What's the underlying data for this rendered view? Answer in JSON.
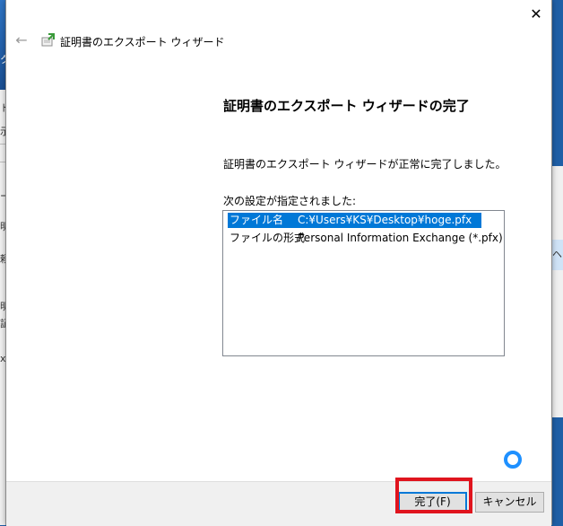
{
  "background": {
    "left_fragments": [
      "ク",
      "ト",
      "示",
      "ー",
      "明",
      "頼",
      "明",
      "証",
      "x"
    ],
    "right_fragments": [
      "ヘ"
    ]
  },
  "dialog": {
    "window_title": "証明書のエクスポート ウィザード",
    "close_glyph": "✕",
    "back_glyph": "←",
    "heading": "証明書のエクスポート ウィザードの完了",
    "completed_message": "証明書のエクスポート ウィザードが正常に完了しました。",
    "settings_label": "次の設定が指定されました:",
    "settings": [
      {
        "key": "ファイル名",
        "value": "C:¥Users¥KS¥Desktop¥hoge.pfx",
        "selected": true
      },
      {
        "key": "ファイルの形式",
        "value": "Personal Information Exchange (*.pfx)",
        "selected": false
      }
    ],
    "buttons": {
      "finish": "完了(F)",
      "cancel": "キャンセル"
    },
    "colors": {
      "selection": "#0078d7",
      "highlight": "#e0141e"
    }
  }
}
